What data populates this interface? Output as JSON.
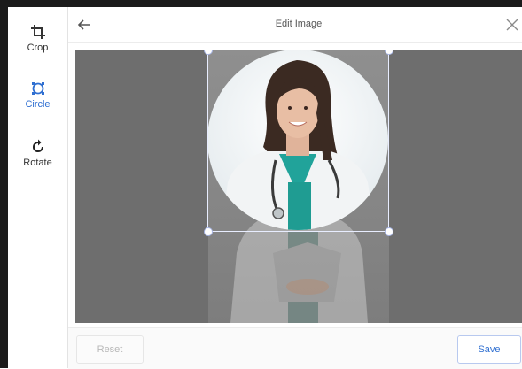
{
  "toolbar": {
    "tools": [
      {
        "label": "Crop",
        "icon": "crop-icon"
      },
      {
        "label": "Circle",
        "icon": "circle-crop-icon",
        "active": true
      },
      {
        "label": "Rotate",
        "icon": "rotate-icon"
      }
    ]
  },
  "header": {
    "title": "Edit Image",
    "back_icon": "arrow-left-icon",
    "close_icon": "close-icon"
  },
  "footer": {
    "reset_label": "Reset",
    "save_label": "Save"
  },
  "colors": {
    "accent": "#2f6fd1",
    "overlay": "#6e6e6e"
  }
}
